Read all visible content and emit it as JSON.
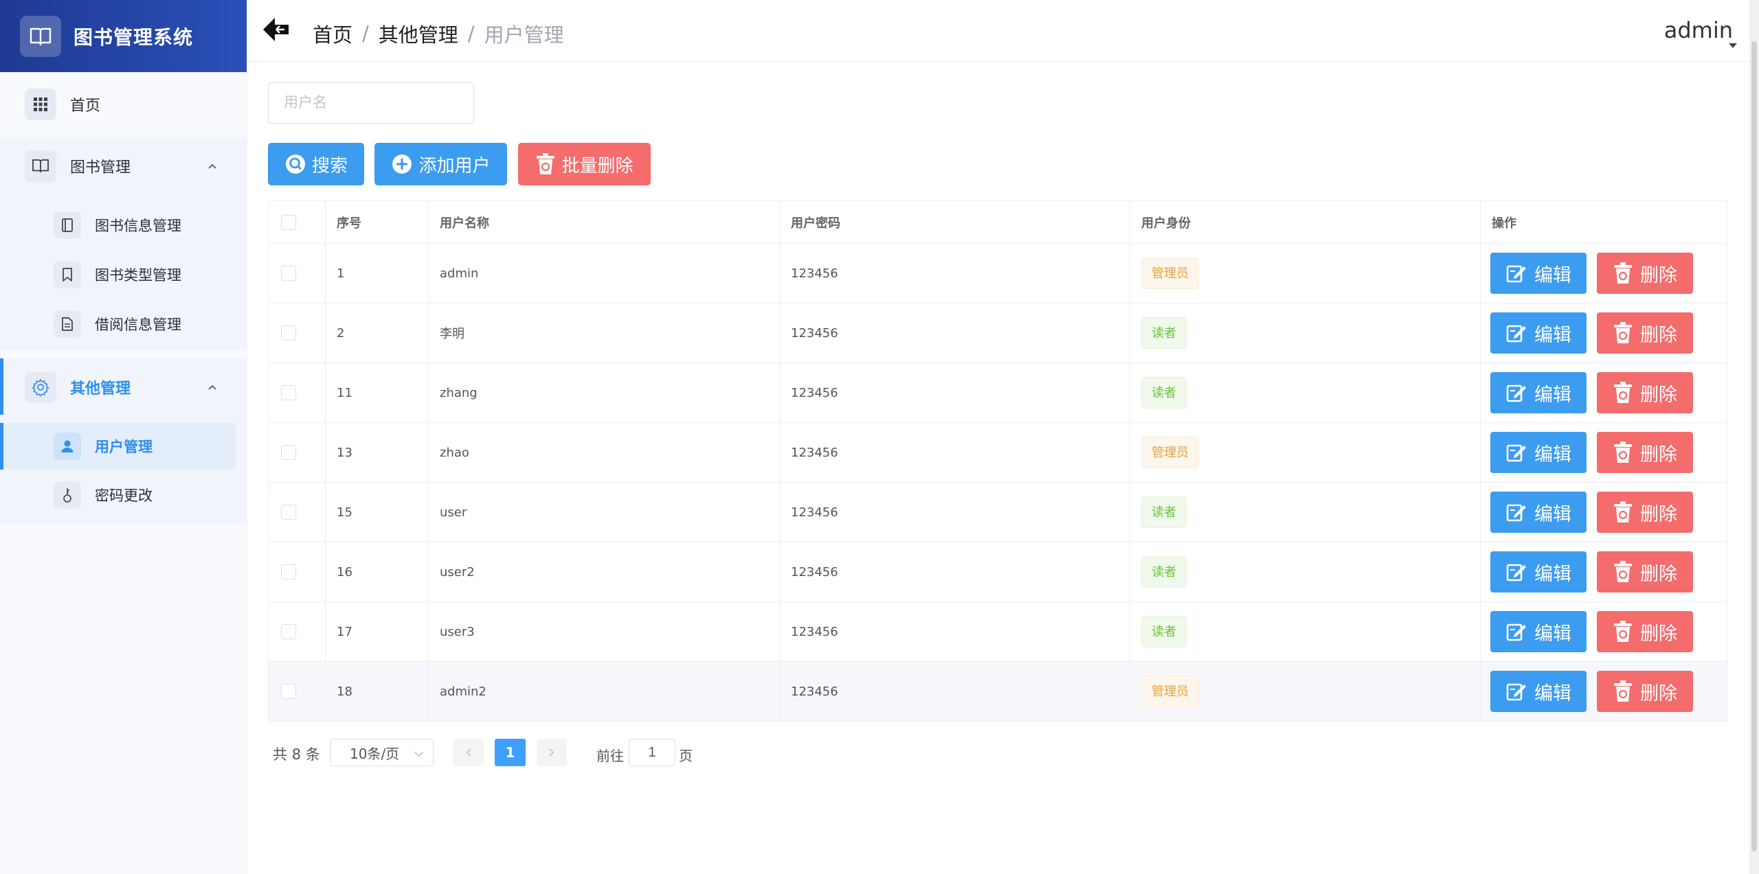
{
  "app": {
    "title": "图书管理系统"
  },
  "sidebar": {
    "home": "首页",
    "book_group": {
      "label": "图书管理",
      "items": [
        {
          "label": "图书信息管理",
          "icon": "book-icon"
        },
        {
          "label": "图书类型管理",
          "icon": "bookmark-icon"
        },
        {
          "label": "借阅信息管理",
          "icon": "document-icon"
        }
      ]
    },
    "other_group": {
      "label": "其他管理",
      "items": [
        {
          "label": "用户管理",
          "icon": "user-icon",
          "active": true
        },
        {
          "label": "密码更改",
          "icon": "key-icon"
        }
      ]
    }
  },
  "header": {
    "breadcrumb": [
      "首页",
      "其他管理",
      "用户管理"
    ],
    "separator": "/",
    "user": "admin"
  },
  "search": {
    "placeholder": "用户名"
  },
  "toolbar": {
    "search": "搜索",
    "add": "添加用户",
    "batch_delete": "批量删除"
  },
  "table": {
    "columns": [
      "序号",
      "用户名称",
      "用户密码",
      "用户身份",
      "操作"
    ],
    "rows": [
      {
        "id": "1",
        "name": "admin",
        "password": "123456",
        "role": "管理员"
      },
      {
        "id": "2",
        "name": "李明",
        "password": "123456",
        "role": "读者"
      },
      {
        "id": "11",
        "name": "zhang",
        "password": "123456",
        "role": "读者"
      },
      {
        "id": "13",
        "name": "zhao",
        "password": "123456",
        "role": "管理员"
      },
      {
        "id": "15",
        "name": "user",
        "password": "123456",
        "role": "读者"
      },
      {
        "id": "16",
        "name": "user2",
        "password": "123456",
        "role": "读者"
      },
      {
        "id": "17",
        "name": "user3",
        "password": "123456",
        "role": "读者"
      },
      {
        "id": "18",
        "name": "admin2",
        "password": "123456",
        "role": "管理员"
      }
    ],
    "edit_label": "编辑",
    "delete_label": "删除"
  },
  "pagination": {
    "total": "共 8 条",
    "page_size": "10条/页",
    "current": "1",
    "goto_label": "前往",
    "goto_value": "1",
    "page_label": "页"
  },
  "colors": {
    "brand": "#1f3a93",
    "primary": "#3b9cf0",
    "danger": "#f46c6c",
    "active": "#2f8ef0"
  }
}
